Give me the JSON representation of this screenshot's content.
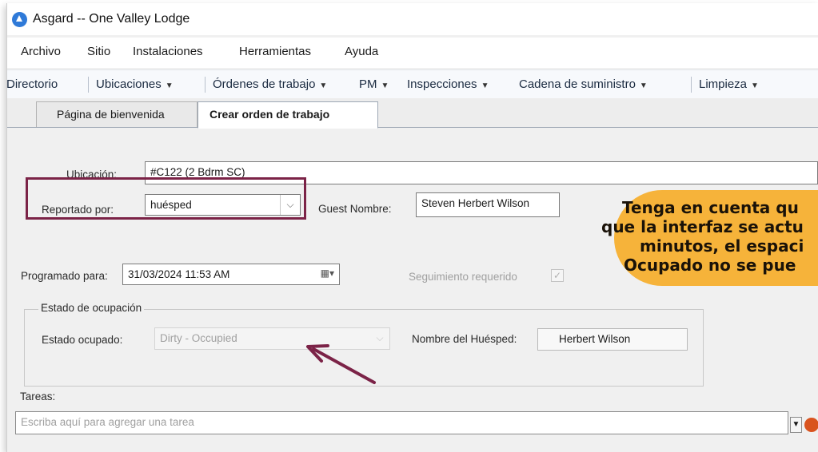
{
  "window": {
    "title": "Asgard -- One Valley Lodge"
  },
  "menu": [
    "Archivo",
    "Sitio",
    "Instalaciones",
    "Herramientas",
    "Ayuda"
  ],
  "toolbar": {
    "directorio": "Directorio",
    "ubicaciones": "Ubicaciones",
    "ordenes": "Órdenes de trabajo",
    "pm": "PM",
    "inspecciones": "Inspecciones",
    "cadena": "Cadena de suministro",
    "limpieza": "Limpieza"
  },
  "tabs": {
    "welcome": "Página de bienvenida",
    "create": "Crear orden de trabajo"
  },
  "form": {
    "ubicacion_label": "Ubicación:",
    "ubicacion_value": "#C122 (2 Bdrm SC)",
    "reportado_label": "Reportado por:",
    "reportado_value": "huésped",
    "guest_label": "Guest Nombre:",
    "guest_value": "Steven Herbert Wilson",
    "programado_label": "Programado para:",
    "programado_value": "31/03/2024 11:53 AM",
    "seguimiento_label": "Seguimiento requerido",
    "estado_group_label": "Estado de ocupación",
    "estado_label": "Estado ocupado:",
    "estado_value": "Dirty - Occupied",
    "nombre_huesped_label": "Nombre del Huésped:",
    "nombre_huesped_value": "Herbert Wilson",
    "tareas_label": "Tareas:",
    "tareas_placeholder": "Escriba aquí para agregar una tarea"
  },
  "callout": {
    "line1": "Tenga en cuenta qu",
    "line2": "que la interfaz se actu",
    "line3": "minutos, el espaci",
    "line4": "Ocupado no se pue"
  },
  "colors": {
    "highlight_border": "#7b2347",
    "arrow": "#7b2347",
    "callout_bg": "#f6b33a"
  }
}
